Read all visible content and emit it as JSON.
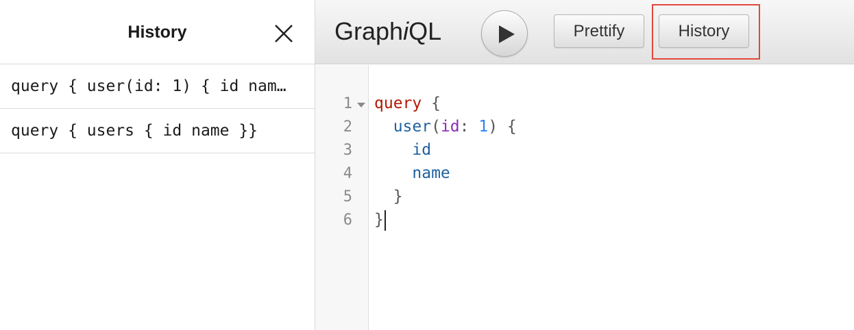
{
  "history_panel": {
    "title": "History",
    "items": [
      {
        "label": "query { user(id: 1) { id nam…"
      },
      {
        "label": "query { users { id name }}"
      }
    ]
  },
  "toolbar": {
    "logo_prefix": "Graph",
    "logo_italic": "i",
    "logo_suffix": "QL",
    "prettify_label": "Prettify",
    "history_label": "History",
    "highlight_color": "#e0483a"
  },
  "editor": {
    "line_numbers": [
      "1",
      "2",
      "3",
      "4",
      "5",
      "6"
    ],
    "tokens": {
      "l1_kw": "query",
      "l1_brace": "{",
      "l2_field": "user",
      "l2_open": "(",
      "l2_arg": "id",
      "l2_colon": ": ",
      "l2_num": "1",
      "l2_close": ") {",
      "l3_field": "id",
      "l4_field": "name",
      "l5_brace": "}",
      "l6_brace": "}"
    }
  }
}
